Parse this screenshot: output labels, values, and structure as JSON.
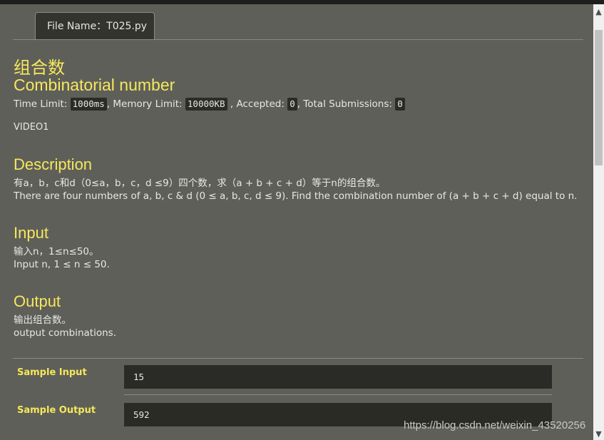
{
  "tab": {
    "label": "File Name：T025.py"
  },
  "header": {
    "title_cn": "组合数",
    "title_en": "Combinatorial number"
  },
  "limits": {
    "time_label": "Time Limit: ",
    "time_value": "1000ms",
    "memory_label": ", Memory Limit: ",
    "memory_value": "10000KB",
    "accepted_label": " , Accepted: ",
    "accepted_value": "0",
    "total_label": ", Total Submissions: ",
    "total_value": "0"
  },
  "video": "VIDEO1",
  "description": {
    "title": "Description",
    "line_cn": "有a，b，c和d（0≤a，b，c，d ≤9）四个数，求（a + b + c + d）等于n的组合数。",
    "line_en": "There are four numbers of a, b, c & d (0 ≤ a, b, c, d ≤ 9). Find the combination number of (a + b + c + d) equal to n."
  },
  "input": {
    "title": "Input",
    "line_cn": "输入n，1≤n≤50。",
    "line_en": "Input n, 1 ≤ n ≤ 50."
  },
  "output": {
    "title": "Output",
    "line_cn": "输出组合数。",
    "line_en": "output combinations."
  },
  "samples": {
    "input_label": "Sample Input",
    "input_value": "15",
    "output_label": "Sample Output",
    "output_value": "592"
  },
  "watermark": "https://blog.csdn.net/weixin_43520256",
  "scrollbar": {
    "up_icon": "▲",
    "down_icon": "▼"
  },
  "colors": {
    "background": "#5f5f59",
    "heading": "#f5e85c",
    "code_bg": "#2b2b27"
  }
}
